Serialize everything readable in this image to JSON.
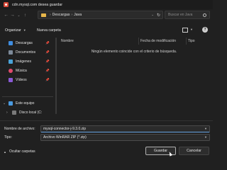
{
  "window": {
    "title": "cdn.mysql.com desea guardar"
  },
  "navigation": {
    "back": "←",
    "forward": "→",
    "dropdown": "⌄",
    "up": "↑",
    "breadcrumb": [
      "Descargas",
      "Java"
    ],
    "refresh": "↻",
    "search_placeholder": "Buscar en Java"
  },
  "toolbar": {
    "organize_label": "Organizar",
    "new_folder_label": "Nueva carpeta"
  },
  "sidebar": {
    "items": [
      {
        "label": "Descargas",
        "icon": "download-icon"
      },
      {
        "label": "Documentos",
        "icon": "documents-icon"
      },
      {
        "label": "Imágenes",
        "icon": "pictures-icon"
      },
      {
        "label": "Música",
        "icon": "music-icon"
      },
      {
        "label": "Vídeos",
        "icon": "videos-icon"
      }
    ],
    "this_pc": "Este equipo",
    "local_disk": "Disco local (C:"
  },
  "file_list": {
    "columns": [
      "Nombre",
      "Fecha de modificación",
      "Tipo"
    ],
    "empty_message": "Ningún elemento coincide con el criterio de búsqueda."
  },
  "form": {
    "filename_label": "Nombre de archivo:",
    "filename_value": "mysql-connector-j-9.3.0.zip",
    "type_label": "Tipo:",
    "type_value": "Archivo WinRAR ZIP (*.zip)"
  },
  "footer": {
    "hide_folders_label": "Ocultar carpetas",
    "save_label": "Guardar",
    "cancel_label": "Cancelar"
  },
  "colors": {
    "background": "#202020",
    "folder": "#e7b64a",
    "app_icon": "#d94a3a"
  }
}
